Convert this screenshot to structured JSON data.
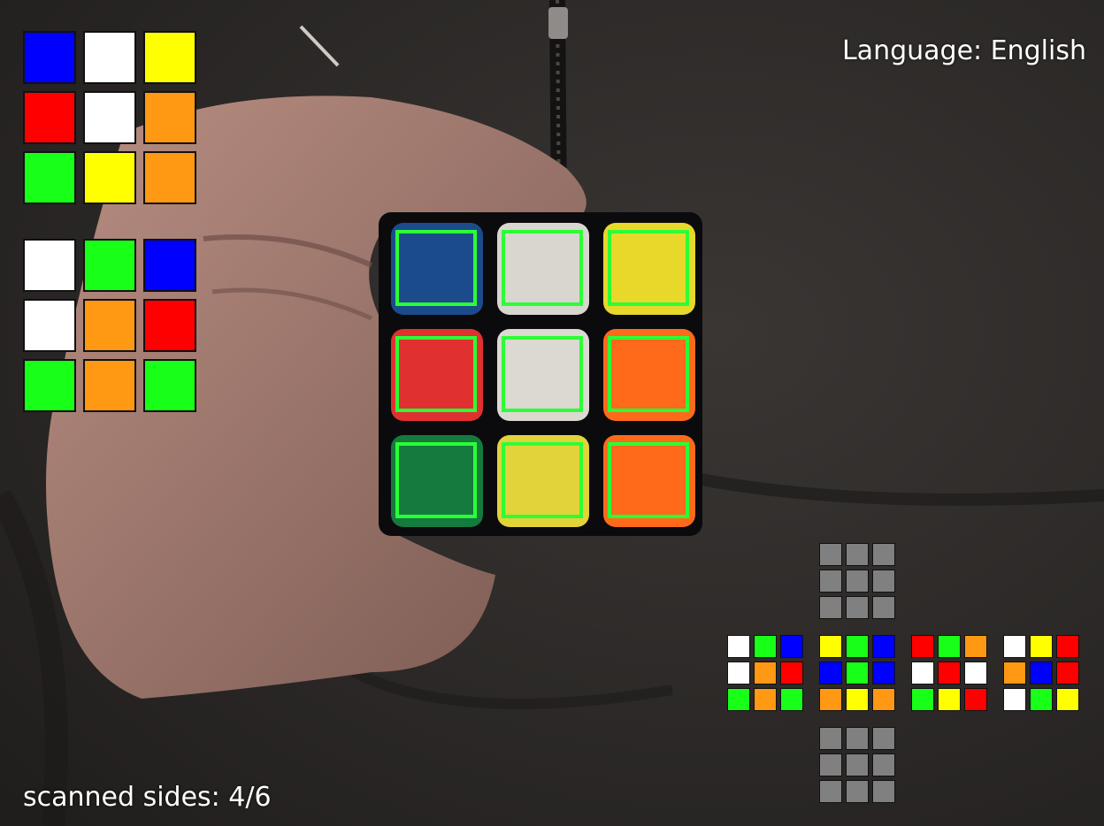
{
  "language_label": "Language: English",
  "status": {
    "label": "scanned sides: ",
    "scanned": 4,
    "total": 6,
    "text": "scanned sides: 4/6"
  },
  "palette": {
    "blue": "#0000ff",
    "white": "#ffffff",
    "yellow": "#ffff00",
    "red": "#ff0000",
    "orange": "#ff9812",
    "green": "#18ff18",
    "gray": "#808080"
  },
  "preview_face": [
    [
      "blue",
      "white",
      "yellow"
    ],
    [
      "red",
      "white",
      "orange"
    ],
    [
      "green",
      "yellow",
      "orange"
    ]
  ],
  "detected_face": [
    [
      "white",
      "green",
      "blue"
    ],
    [
      "white",
      "orange",
      "red"
    ],
    [
      "green",
      "orange",
      "green"
    ]
  ],
  "camera_cube": {
    "tiles": [
      [
        "#1c4b8c",
        "#d9d6cf",
        "#e7d82a"
      ],
      [
        "#e03030",
        "#dcd8d2",
        "#ff6a1a"
      ],
      [
        "#157a3e",
        "#e2d33a",
        "#ff6a1a"
      ]
    ],
    "frame_color": "#2bff35"
  },
  "net": {
    "up": [
      [
        "gray",
        "gray",
        "gray"
      ],
      [
        "gray",
        "gray",
        "gray"
      ],
      [
        "gray",
        "gray",
        "gray"
      ]
    ],
    "left": [
      [
        "white",
        "green",
        "blue"
      ],
      [
        "white",
        "orange",
        "red"
      ],
      [
        "green",
        "orange",
        "green"
      ]
    ],
    "front": [
      [
        "yellow",
        "green",
        "blue"
      ],
      [
        "blue",
        "green",
        "blue"
      ],
      [
        "orange",
        "yellow",
        "orange"
      ]
    ],
    "right": [
      [
        "red",
        "green",
        "orange"
      ],
      [
        "white",
        "red",
        "white"
      ],
      [
        "green",
        "yellow",
        "red"
      ]
    ],
    "back": [
      [
        "white",
        "yellow",
        "red"
      ],
      [
        "orange",
        "blue",
        "red"
      ],
      [
        "white",
        "green",
        "yellow"
      ]
    ],
    "down": [
      [
        "gray",
        "gray",
        "gray"
      ],
      [
        "gray",
        "gray",
        "gray"
      ],
      [
        "gray",
        "gray",
        "gray"
      ]
    ]
  }
}
